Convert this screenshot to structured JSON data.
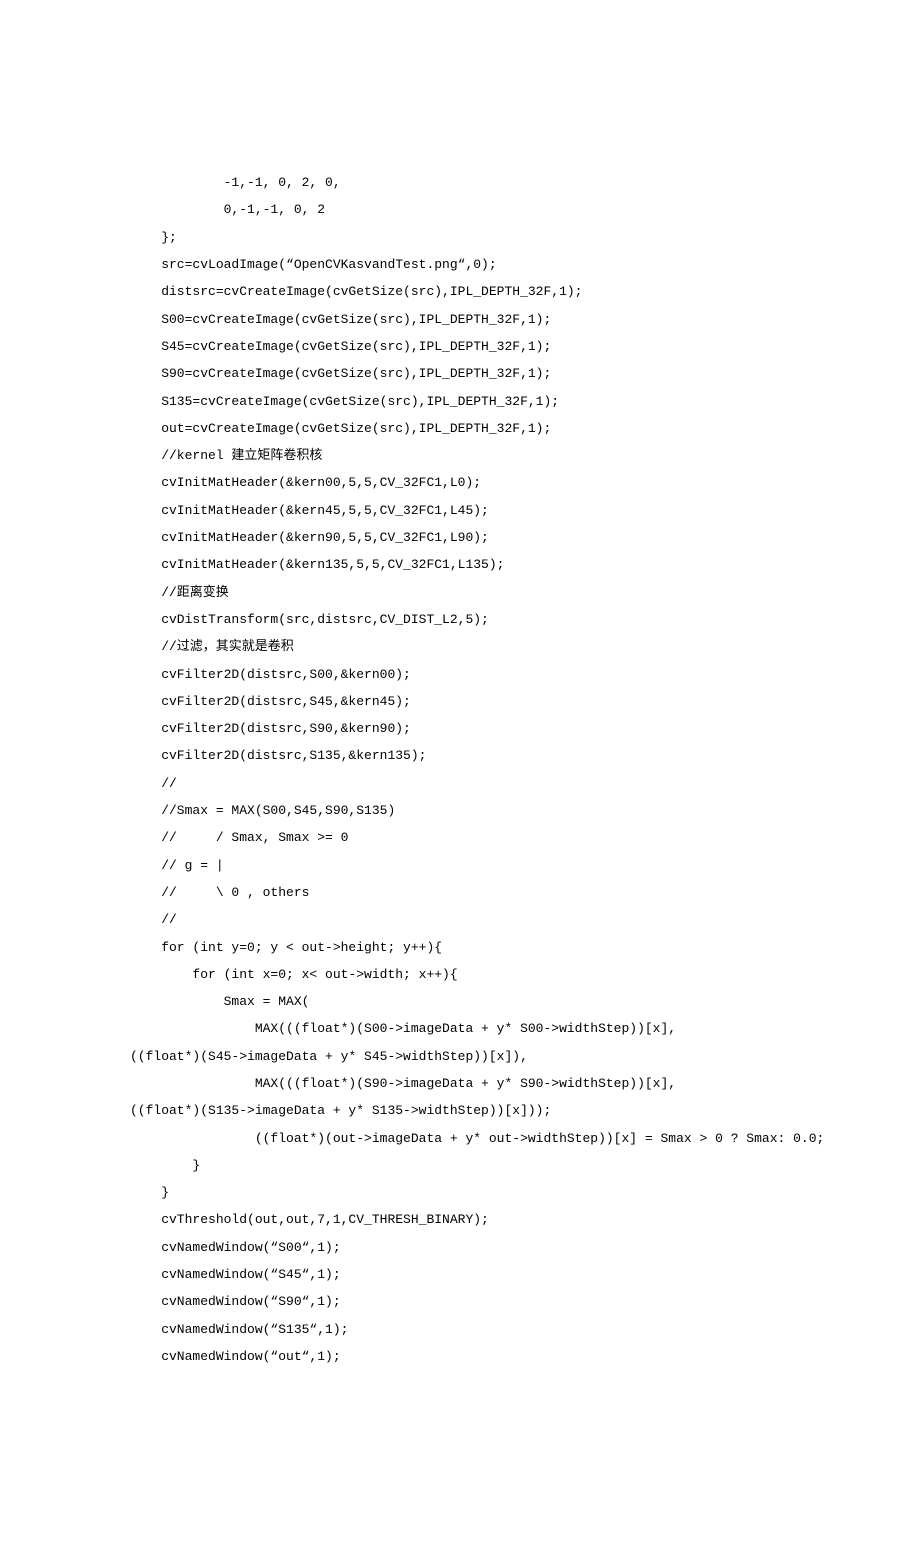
{
  "lines": [
    "            -1,-1, 0, 2, 0,",
    "            0,-1,-1, 0, 2",
    "    };",
    "    src=cvLoadImage(“OpenCVKasvandTest.png“,0);",
    "    distsrc=cvCreateImage(cvGetSize(src),IPL_DEPTH_32F,1);",
    "    S00=cvCreateImage(cvGetSize(src),IPL_DEPTH_32F,1);",
    "    S45=cvCreateImage(cvGetSize(src),IPL_DEPTH_32F,1);",
    "    S90=cvCreateImage(cvGetSize(src),IPL_DEPTH_32F,1);",
    "    S135=cvCreateImage(cvGetSize(src),IPL_DEPTH_32F,1);",
    "    out=cvCreateImage(cvGetSize(src),IPL_DEPTH_32F,1);",
    "    //kernel 建立矩阵卷积核",
    "    cvInitMatHeader(&kern00,5,5,CV_32FC1,L0);",
    "    cvInitMatHeader(&kern45,5,5,CV_32FC1,L45);",
    "    cvInitMatHeader(&kern90,5,5,CV_32FC1,L90);",
    "    cvInitMatHeader(&kern135,5,5,CV_32FC1,L135);",
    "    //距离变换",
    "    cvDistTransform(src,distsrc,CV_DIST_L2,5);",
    "    //过滤，其实就是卷积",
    "    cvFilter2D(distsrc,S00,&kern00);",
    "    cvFilter2D(distsrc,S45,&kern45);",
    "    cvFilter2D(distsrc,S90,&kern90);",
    "    cvFilter2D(distsrc,S135,&kern135);",
    "    //",
    "    //Smax = MAX(S00,S45,S90,S135)",
    "    //     / Smax, Smax >= 0",
    "    // g = |",
    "    //     \\ 0 , others",
    "    //",
    "    for (int y=0; y < out->height; y++){",
    "        for (int x=0; x< out->width; x++){",
    "            Smax = MAX(",
    "                MAX(((float*)(S00->imageData + y* S00->widthStep))[x],",
    "((float*)(S45->imageData + y* S45->widthStep))[x]),",
    "                MAX(((float*)(S90->imageData + y* S90->widthStep))[x],",
    "((float*)(S135->imageData + y* S135->widthStep))[x]));",
    "                ((float*)(out->imageData + y* out->widthStep))[x] = Smax > 0 ? Smax: 0.0;",
    "        }",
    "    }",
    "    cvThreshold(out,out,7,1,CV_THRESH_BINARY);",
    "    cvNamedWindow(“S00“,1);",
    "    cvNamedWindow(“S45“,1);",
    "    cvNamedWindow(“S90“,1);",
    "    cvNamedWindow(“S135“,1);",
    "    cvNamedWindow(“out“,1);"
  ]
}
